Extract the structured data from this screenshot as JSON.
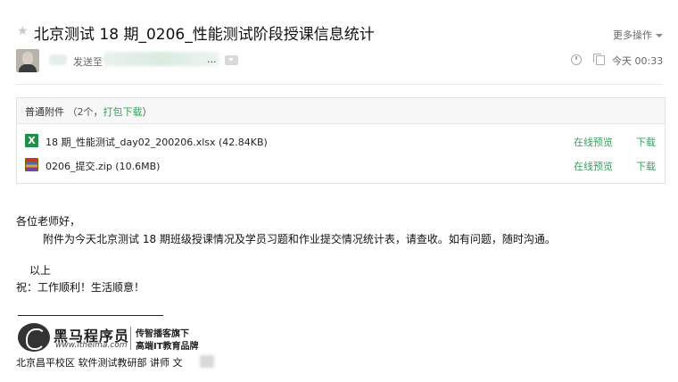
{
  "header": {
    "subject": "北京测试 18 期_0206_性能测试阶段授课信息统计",
    "more_actions": "更多操作",
    "sent_to_label": "发送至",
    "recipients_overflow": "...",
    "date": "今天 00:33"
  },
  "attachments": {
    "section_label": "普通附件",
    "count_text": "（2个，",
    "pack_download": "打包下载",
    "count_close": "）",
    "files": [
      {
        "name": "18 期_性能测试_day02_200206.xlsx (42.84KB)",
        "icon": "excel-icon",
        "preview": "在线预览",
        "download": "下载"
      },
      {
        "name": "0206_提交.zip (10.6MB)",
        "icon": "zip-archive-icon",
        "preview": "在线预览",
        "download": "下载"
      }
    ]
  },
  "body": {
    "greeting": "各位老师好，",
    "content": "附件为今天北京测试 18 期班级授课情况及学员习题和作业提交情况统计表，请查收。如有问题，随时沟通。",
    "closing": "以上",
    "wish": "祝：工作顺利！生活顺意！"
  },
  "signature": {
    "logo_name": "黑马程序员",
    "logo_url": "www.itheima.com",
    "logo_tag_1": "传智播客旗下",
    "logo_tag_2": "高端IT教育品牌",
    "line": "北京昌平校区  软件测试教研部  讲师      文"
  },
  "colors": {
    "link_green": "#3aa060",
    "excel_green": "#1f8f4c"
  }
}
